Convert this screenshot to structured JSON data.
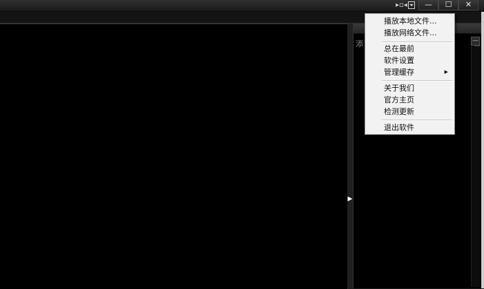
{
  "titlebar": {
    "icons": {
      "mini_mode": "film-strip-icon",
      "skin": "download-arrow-icon"
    },
    "minimize_label": "—",
    "maximize_label": "☐",
    "close_label": "✕"
  },
  "right_panel": {
    "partial_text_left": "添",
    "partial_text_right": "表"
  },
  "menu": {
    "play_local_file": "播放本地文件...",
    "play_network_file": "播放网络文件...",
    "always_on_top": "总在最前",
    "software_settings": "软件设置",
    "manage_cache": "管理缓存",
    "about_us": "关于我们",
    "official_homepage": "官方主页",
    "check_update": "检测更新",
    "exit_software": "退出软件"
  }
}
